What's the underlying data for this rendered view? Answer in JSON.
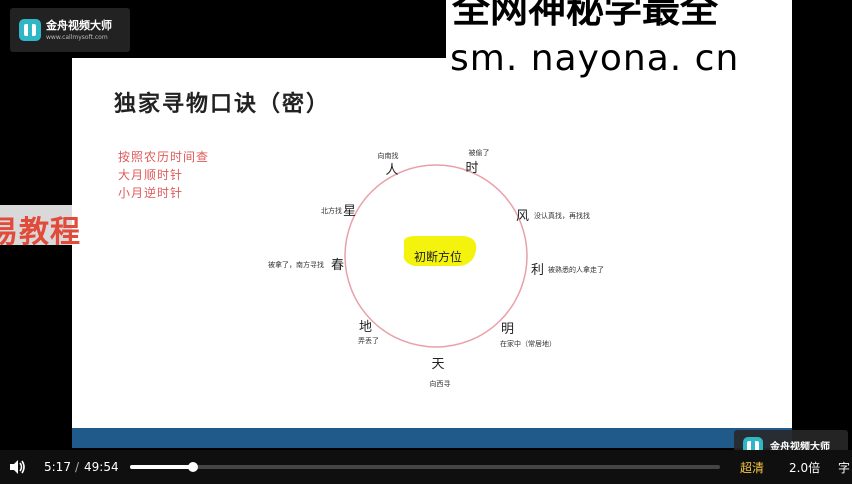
{
  "player": {
    "current_time": "5:17",
    "separator": "/",
    "total_time": "49:54",
    "progress": 0.106,
    "quality": "超清",
    "speed": "2.0倍",
    "subtitle_button": "字"
  },
  "overlays": {
    "top_logo": "金舟视频大师",
    "top_logo_sub": "www.callmysoft.com",
    "bottom_logo": "金舟视频大师",
    "watermark_line1": "全网神秘学最全",
    "watermark_line2": "sm. nayona. cn",
    "side_text": "易教程"
  },
  "slide": {
    "title": "独家寻物口诀（密）",
    "rules": [
      "按照农历时间查",
      "大月顺时针",
      "小月逆时针"
    ],
    "center_label": "初断方位",
    "dial": [
      {
        "char": "人",
        "note": "向南找"
      },
      {
        "char": "时",
        "note": "被偷了"
      },
      {
        "char": "风",
        "note": "没认真找，再找找"
      },
      {
        "char": "利",
        "note": "被熟悉的人拿走了"
      },
      {
        "char": "明",
        "note": "在家中（常居地）"
      },
      {
        "char": "天",
        "note": "向西寻"
      },
      {
        "char": "地",
        "note": "弄丢了"
      },
      {
        "char": "春",
        "note": "被拿了，南方寻找"
      },
      {
        "char": "星",
        "note": "北方找"
      }
    ]
  },
  "colors": {
    "rule_text": "#e05a5a",
    "circle": "#e8a0a8",
    "highlight": "#f2f200",
    "slide_footer": "#1f5a8a",
    "quality": "#f5c542"
  }
}
